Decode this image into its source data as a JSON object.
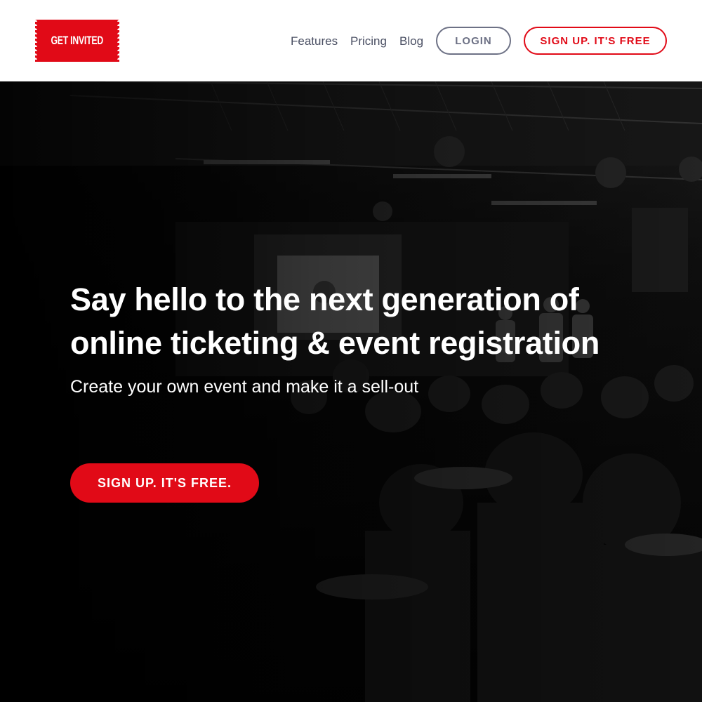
{
  "header": {
    "logo_text": "GET INVITED",
    "nav": [
      {
        "label": "Features"
      },
      {
        "label": "Pricing"
      },
      {
        "label": "Blog"
      }
    ],
    "login_label": "LOGIN",
    "signup_label": "SIGN UP. IT'S FREE"
  },
  "hero": {
    "headline": "Say hello to the next generation of online ticketing & event registration",
    "subhead": "Create your own event and make it a sell-out",
    "cta_label": "SIGN UP. IT'S FREE."
  },
  "colors": {
    "brand_red": "#e10a17",
    "nav_text": "#4a4f63",
    "login_border": "#6d7185",
    "header_bg": "#ffffff"
  }
}
